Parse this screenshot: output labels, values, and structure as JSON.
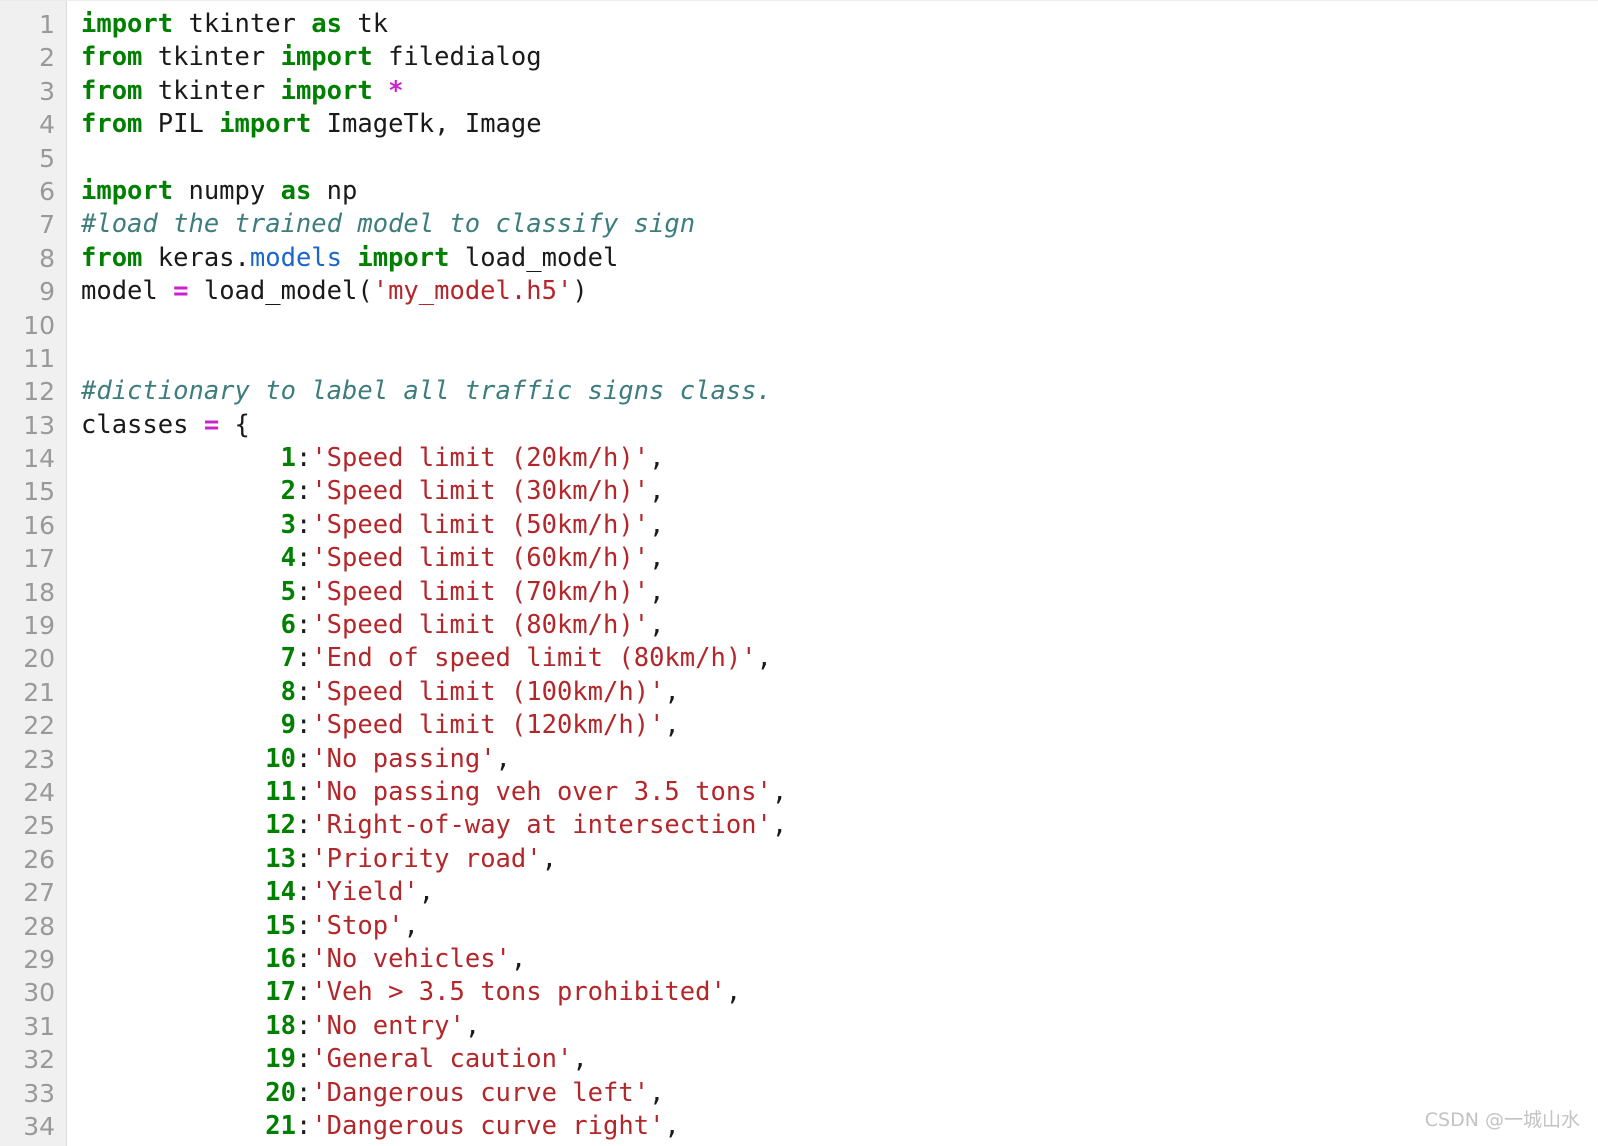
{
  "editor": {
    "language": "python",
    "background_color": "#ffffff",
    "gutter_color": "#f0f0f0",
    "line_number_color": "#999999",
    "first_line_number": 1,
    "last_visible_line_number": 34,
    "last_line_clipped": true
  },
  "theme_colors": {
    "keyword": "#008000",
    "string": "#b3262a",
    "number": "#008000",
    "comment": "#3d7d7d",
    "operator": "#cc22cc",
    "module": "#1a66cc",
    "plain": "#1a1a1a"
  },
  "watermark": {
    "text": "CSDN @一城山水"
  },
  "lines": [
    {
      "n": 1,
      "tokens": [
        {
          "t": "kw",
          "v": "import"
        },
        {
          "t": "pln",
          "v": " tkinter "
        },
        {
          "t": "kw",
          "v": "as"
        },
        {
          "t": "pln",
          "v": " tk"
        }
      ]
    },
    {
      "n": 2,
      "tokens": [
        {
          "t": "kw",
          "v": "from"
        },
        {
          "t": "pln",
          "v": " tkinter "
        },
        {
          "t": "kw",
          "v": "import"
        },
        {
          "t": "pln",
          "v": " filedialog"
        }
      ]
    },
    {
      "n": 3,
      "tokens": [
        {
          "t": "kw",
          "v": "from"
        },
        {
          "t": "pln",
          "v": " tkinter "
        },
        {
          "t": "kw",
          "v": "import"
        },
        {
          "t": "pln",
          "v": " "
        },
        {
          "t": "op",
          "v": "*"
        }
      ]
    },
    {
      "n": 4,
      "tokens": [
        {
          "t": "kw",
          "v": "from"
        },
        {
          "t": "pln",
          "v": " PIL "
        },
        {
          "t": "kw",
          "v": "import"
        },
        {
          "t": "pln",
          "v": " ImageTk, Image"
        }
      ]
    },
    {
      "n": 5,
      "tokens": []
    },
    {
      "n": 6,
      "tokens": [
        {
          "t": "kw",
          "v": "import"
        },
        {
          "t": "pln",
          "v": " numpy "
        },
        {
          "t": "kw",
          "v": "as"
        },
        {
          "t": "pln",
          "v": " np"
        }
      ]
    },
    {
      "n": 7,
      "tokens": [
        {
          "t": "com",
          "v": "#load the trained model to classify sign"
        }
      ]
    },
    {
      "n": 8,
      "tokens": [
        {
          "t": "kw",
          "v": "from"
        },
        {
          "t": "pln",
          "v": " keras."
        },
        {
          "t": "mod",
          "v": "models"
        },
        {
          "t": "pln",
          "v": " "
        },
        {
          "t": "kw",
          "v": "import"
        },
        {
          "t": "pln",
          "v": " load_model"
        }
      ]
    },
    {
      "n": 9,
      "tokens": [
        {
          "t": "pln",
          "v": "model "
        },
        {
          "t": "op",
          "v": "="
        },
        {
          "t": "pln",
          "v": " load_model("
        },
        {
          "t": "str",
          "v": "'my_model.h5'"
        },
        {
          "t": "pln",
          "v": ")"
        }
      ]
    },
    {
      "n": 10,
      "tokens": []
    },
    {
      "n": 11,
      "tokens": []
    },
    {
      "n": 12,
      "tokens": [
        {
          "t": "com",
          "v": "#dictionary to label all traffic signs class."
        }
      ]
    },
    {
      "n": 13,
      "tokens": [
        {
          "t": "pln",
          "v": "classes "
        },
        {
          "t": "op",
          "v": "="
        },
        {
          "t": "pln",
          "v": " {"
        }
      ]
    },
    {
      "n": 14,
      "tokens": [
        {
          "t": "pln",
          "v": "            "
        },
        {
          "t": "num",
          "v": " 1"
        },
        {
          "t": "pln",
          "v": ":"
        },
        {
          "t": "str",
          "v": "'Speed limit (20km/h)'"
        },
        {
          "t": "pln",
          "v": ","
        }
      ]
    },
    {
      "n": 15,
      "tokens": [
        {
          "t": "pln",
          "v": "            "
        },
        {
          "t": "num",
          "v": " 2"
        },
        {
          "t": "pln",
          "v": ":"
        },
        {
          "t": "str",
          "v": "'Speed limit (30km/h)'"
        },
        {
          "t": "pln",
          "v": ","
        }
      ]
    },
    {
      "n": 16,
      "tokens": [
        {
          "t": "pln",
          "v": "            "
        },
        {
          "t": "num",
          "v": " 3"
        },
        {
          "t": "pln",
          "v": ":"
        },
        {
          "t": "str",
          "v": "'Speed limit (50km/h)'"
        },
        {
          "t": "pln",
          "v": ","
        }
      ]
    },
    {
      "n": 17,
      "tokens": [
        {
          "t": "pln",
          "v": "            "
        },
        {
          "t": "num",
          "v": " 4"
        },
        {
          "t": "pln",
          "v": ":"
        },
        {
          "t": "str",
          "v": "'Speed limit (60km/h)'"
        },
        {
          "t": "pln",
          "v": ","
        }
      ]
    },
    {
      "n": 18,
      "tokens": [
        {
          "t": "pln",
          "v": "            "
        },
        {
          "t": "num",
          "v": " 5"
        },
        {
          "t": "pln",
          "v": ":"
        },
        {
          "t": "str",
          "v": "'Speed limit (70km/h)'"
        },
        {
          "t": "pln",
          "v": ","
        }
      ]
    },
    {
      "n": 19,
      "tokens": [
        {
          "t": "pln",
          "v": "            "
        },
        {
          "t": "num",
          "v": " 6"
        },
        {
          "t": "pln",
          "v": ":"
        },
        {
          "t": "str",
          "v": "'Speed limit (80km/h)'"
        },
        {
          "t": "pln",
          "v": ","
        }
      ]
    },
    {
      "n": 20,
      "tokens": [
        {
          "t": "pln",
          "v": "            "
        },
        {
          "t": "num",
          "v": " 7"
        },
        {
          "t": "pln",
          "v": ":"
        },
        {
          "t": "str",
          "v": "'End of speed limit (80km/h)'"
        },
        {
          "t": "pln",
          "v": ","
        }
      ]
    },
    {
      "n": 21,
      "tokens": [
        {
          "t": "pln",
          "v": "            "
        },
        {
          "t": "num",
          "v": " 8"
        },
        {
          "t": "pln",
          "v": ":"
        },
        {
          "t": "str",
          "v": "'Speed limit (100km/h)'"
        },
        {
          "t": "pln",
          "v": ","
        }
      ]
    },
    {
      "n": 22,
      "tokens": [
        {
          "t": "pln",
          "v": "            "
        },
        {
          "t": "num",
          "v": " 9"
        },
        {
          "t": "pln",
          "v": ":"
        },
        {
          "t": "str",
          "v": "'Speed limit (120km/h)'"
        },
        {
          "t": "pln",
          "v": ","
        }
      ]
    },
    {
      "n": 23,
      "tokens": [
        {
          "t": "pln",
          "v": "            "
        },
        {
          "t": "num",
          "v": "10"
        },
        {
          "t": "pln",
          "v": ":"
        },
        {
          "t": "str",
          "v": "'No passing'"
        },
        {
          "t": "pln",
          "v": ","
        }
      ]
    },
    {
      "n": 24,
      "tokens": [
        {
          "t": "pln",
          "v": "            "
        },
        {
          "t": "num",
          "v": "11"
        },
        {
          "t": "pln",
          "v": ":"
        },
        {
          "t": "str",
          "v": "'No passing veh over 3.5 tons'"
        },
        {
          "t": "pln",
          "v": ","
        }
      ]
    },
    {
      "n": 25,
      "tokens": [
        {
          "t": "pln",
          "v": "            "
        },
        {
          "t": "num",
          "v": "12"
        },
        {
          "t": "pln",
          "v": ":"
        },
        {
          "t": "str",
          "v": "'Right-of-way at intersection'"
        },
        {
          "t": "pln",
          "v": ","
        }
      ]
    },
    {
      "n": 26,
      "tokens": [
        {
          "t": "pln",
          "v": "            "
        },
        {
          "t": "num",
          "v": "13"
        },
        {
          "t": "pln",
          "v": ":"
        },
        {
          "t": "str",
          "v": "'Priority road'"
        },
        {
          "t": "pln",
          "v": ","
        }
      ]
    },
    {
      "n": 27,
      "tokens": [
        {
          "t": "pln",
          "v": "            "
        },
        {
          "t": "num",
          "v": "14"
        },
        {
          "t": "pln",
          "v": ":"
        },
        {
          "t": "str",
          "v": "'Yield'"
        },
        {
          "t": "pln",
          "v": ","
        }
      ]
    },
    {
      "n": 28,
      "tokens": [
        {
          "t": "pln",
          "v": "            "
        },
        {
          "t": "num",
          "v": "15"
        },
        {
          "t": "pln",
          "v": ":"
        },
        {
          "t": "str",
          "v": "'Stop'"
        },
        {
          "t": "pln",
          "v": ","
        }
      ]
    },
    {
      "n": 29,
      "tokens": [
        {
          "t": "pln",
          "v": "            "
        },
        {
          "t": "num",
          "v": "16"
        },
        {
          "t": "pln",
          "v": ":"
        },
        {
          "t": "str",
          "v": "'No vehicles'"
        },
        {
          "t": "pln",
          "v": ","
        }
      ]
    },
    {
      "n": 30,
      "tokens": [
        {
          "t": "pln",
          "v": "            "
        },
        {
          "t": "num",
          "v": "17"
        },
        {
          "t": "pln",
          "v": ":"
        },
        {
          "t": "str",
          "v": "'Veh > 3.5 tons prohibited'"
        },
        {
          "t": "pln",
          "v": ","
        }
      ]
    },
    {
      "n": 31,
      "tokens": [
        {
          "t": "pln",
          "v": "            "
        },
        {
          "t": "num",
          "v": "18"
        },
        {
          "t": "pln",
          "v": ":"
        },
        {
          "t": "str",
          "v": "'No entry'"
        },
        {
          "t": "pln",
          "v": ","
        }
      ]
    },
    {
      "n": 32,
      "tokens": [
        {
          "t": "pln",
          "v": "            "
        },
        {
          "t": "num",
          "v": "19"
        },
        {
          "t": "pln",
          "v": ":"
        },
        {
          "t": "str",
          "v": "'General caution'"
        },
        {
          "t": "pln",
          "v": ","
        }
      ]
    },
    {
      "n": 33,
      "tokens": [
        {
          "t": "pln",
          "v": "            "
        },
        {
          "t": "num",
          "v": "20"
        },
        {
          "t": "pln",
          "v": ":"
        },
        {
          "t": "str",
          "v": "'Dangerous curve left'"
        },
        {
          "t": "pln",
          "v": ","
        }
      ]
    },
    {
      "n": 34,
      "tokens": [
        {
          "t": "pln",
          "v": "            "
        },
        {
          "t": "num",
          "v": "21"
        },
        {
          "t": "pln",
          "v": ":"
        },
        {
          "t": "str",
          "v": "'Dangerous curve right'"
        },
        {
          "t": "pln",
          "v": ","
        }
      ]
    }
  ]
}
